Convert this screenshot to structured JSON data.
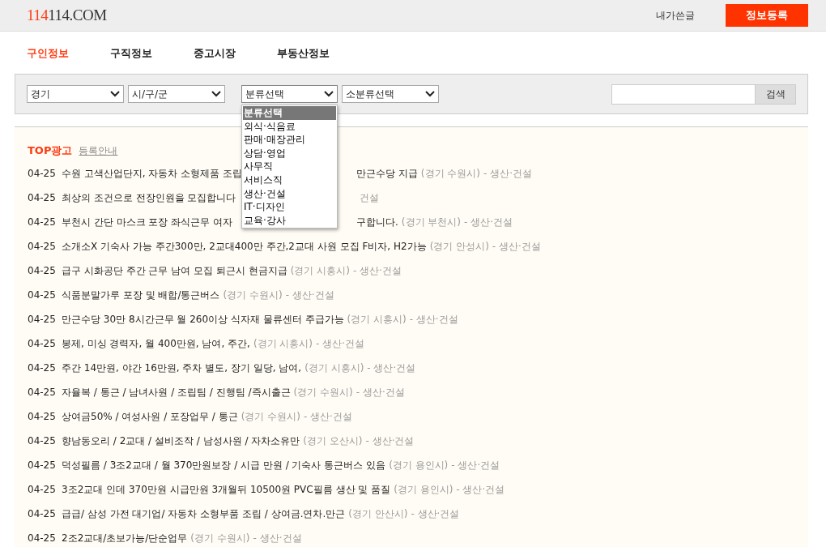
{
  "header": {
    "logo_accent": "114",
    "logo_rest": "114.COM",
    "my_posts": "내가쓴글",
    "register_button": "정보등록"
  },
  "tabs": [
    {
      "label": "구인정보",
      "selected": true
    },
    {
      "label": "구직정보",
      "selected": false
    },
    {
      "label": "중고시장",
      "selected": false
    },
    {
      "label": "부동산정보",
      "selected": false
    }
  ],
  "filters": {
    "selects": [
      {
        "value": "경기"
      },
      {
        "value": "시/구/군"
      },
      {
        "value": "분류선택",
        "expanded": true
      },
      {
        "value": "소분류선택"
      }
    ],
    "search_button": "검색"
  },
  "dropdown": [
    {
      "label": "분류선택",
      "selected": true
    },
    {
      "label": "외식·식음료",
      "selected": false
    },
    {
      "label": "판매·매장관리",
      "selected": false
    },
    {
      "label": "상담·영업",
      "selected": false
    },
    {
      "label": "사무직",
      "selected": false
    },
    {
      "label": "서비스직",
      "selected": false
    },
    {
      "label": "생산·건설",
      "selected": false
    },
    {
      "label": "IT·디자인",
      "selected": false
    },
    {
      "label": "교육·강사",
      "selected": false
    }
  ],
  "top_ads": {
    "title": "TOP광고",
    "guide_link": "등록안내"
  },
  "rows": [
    {
      "date": "04-25",
      "title": "수원 고색산업단지, 자동차 소형제품 조립",
      "after": {
        "title": "만근수당 지급",
        "location": "(경기 수원시)",
        "category": "- 생산·건설"
      }
    },
    {
      "date": "04-25",
      "title": "최상의 조건으로 전장인원을 모집합니다",
      "after": {
        "category": "건설"
      }
    },
    {
      "date": "04-25",
      "title": "부천시 간단 마스크 포장 좌식근무 여자",
      "after": {
        "title": "구합니다.",
        "location": "(경기 부천시)",
        "category": "- 생산·건설"
      }
    },
    {
      "date": "04-25",
      "title": "소개소X 기숙사 가능 주간300만, 2교대400만 주간,2교대 사원 모집 F비자, H2가능",
      "location": "(경기 안성시)",
      "category": "- 생산·건설"
    },
    {
      "date": "04-25",
      "title": "급구 시화공단 주간 근무 남여 모집 퇴근시 현금지급",
      "location": "(경기 시흥시)",
      "category": "- 생산·건설"
    },
    {
      "date": "04-25",
      "title": "식품분말가루 포장 및 배합/통근버스",
      "location": "(경기 수원시)",
      "category": "- 생산·건설"
    },
    {
      "date": "04-25",
      "title": "만근수당 30만 8시간근무 월 260이상 식자재 물류센터 주급가능",
      "location": "(경기 시흥시)",
      "category": "- 생산·건설"
    },
    {
      "date": "04-25",
      "title": "봉제, 미싱 경력자, 월 400만원, 남여, 주간,",
      "location": "(경기 시흥시)",
      "category": "- 생산·건설"
    },
    {
      "date": "04-25",
      "title": "주간 14만원, 야간 16만원, 주차 별도, 장기 일당, 남여,",
      "location": "(경기 시흥시)",
      "category": "- 생산·건설"
    },
    {
      "date": "04-25",
      "title": "자율복 / 통근 / 남녀사원 / 조립팀 / 진행팀 /즉시출근",
      "location": "(경기 수원시)",
      "category": "- 생산·건설"
    },
    {
      "date": "04-25",
      "title": "상여금50% / 여성사원 / 포장업무 / 통근",
      "location": "(경기 수원시)",
      "category": "- 생산·건설"
    },
    {
      "date": "04-25",
      "title": "향남동오리 / 2교대 / 설비조작 / 남성사원 / 자차소유만",
      "location": "(경기 오산시)",
      "category": "- 생산·건설"
    },
    {
      "date": "04-25",
      "title": "덕성필름 / 3조2교대 / 월 370만원보장 / 시급 만원 / 기숙사 통근버스 있음",
      "location": "(경기 용인시)",
      "category": "- 생산·건설"
    },
    {
      "date": "04-25",
      "title": "3조2교대 인데 370만원 시급만원 3개월뒤 10500원 PVC필름 생산 및 품질",
      "location": "(경기 용인시)",
      "category": "- 생산·건설"
    },
    {
      "date": "04-25",
      "title": "급급/ 삼성 가전 대기업/ 자동차 소형부품 조립 / 상여금.연차.만근",
      "location": "(경기 안산시)",
      "category": "- 생산·건설"
    },
    {
      "date": "04-25",
      "title": "2조2교대/초보가능/단순업무",
      "location": "(경기 수원시)",
      "category": "- 생산·건설"
    }
  ]
}
